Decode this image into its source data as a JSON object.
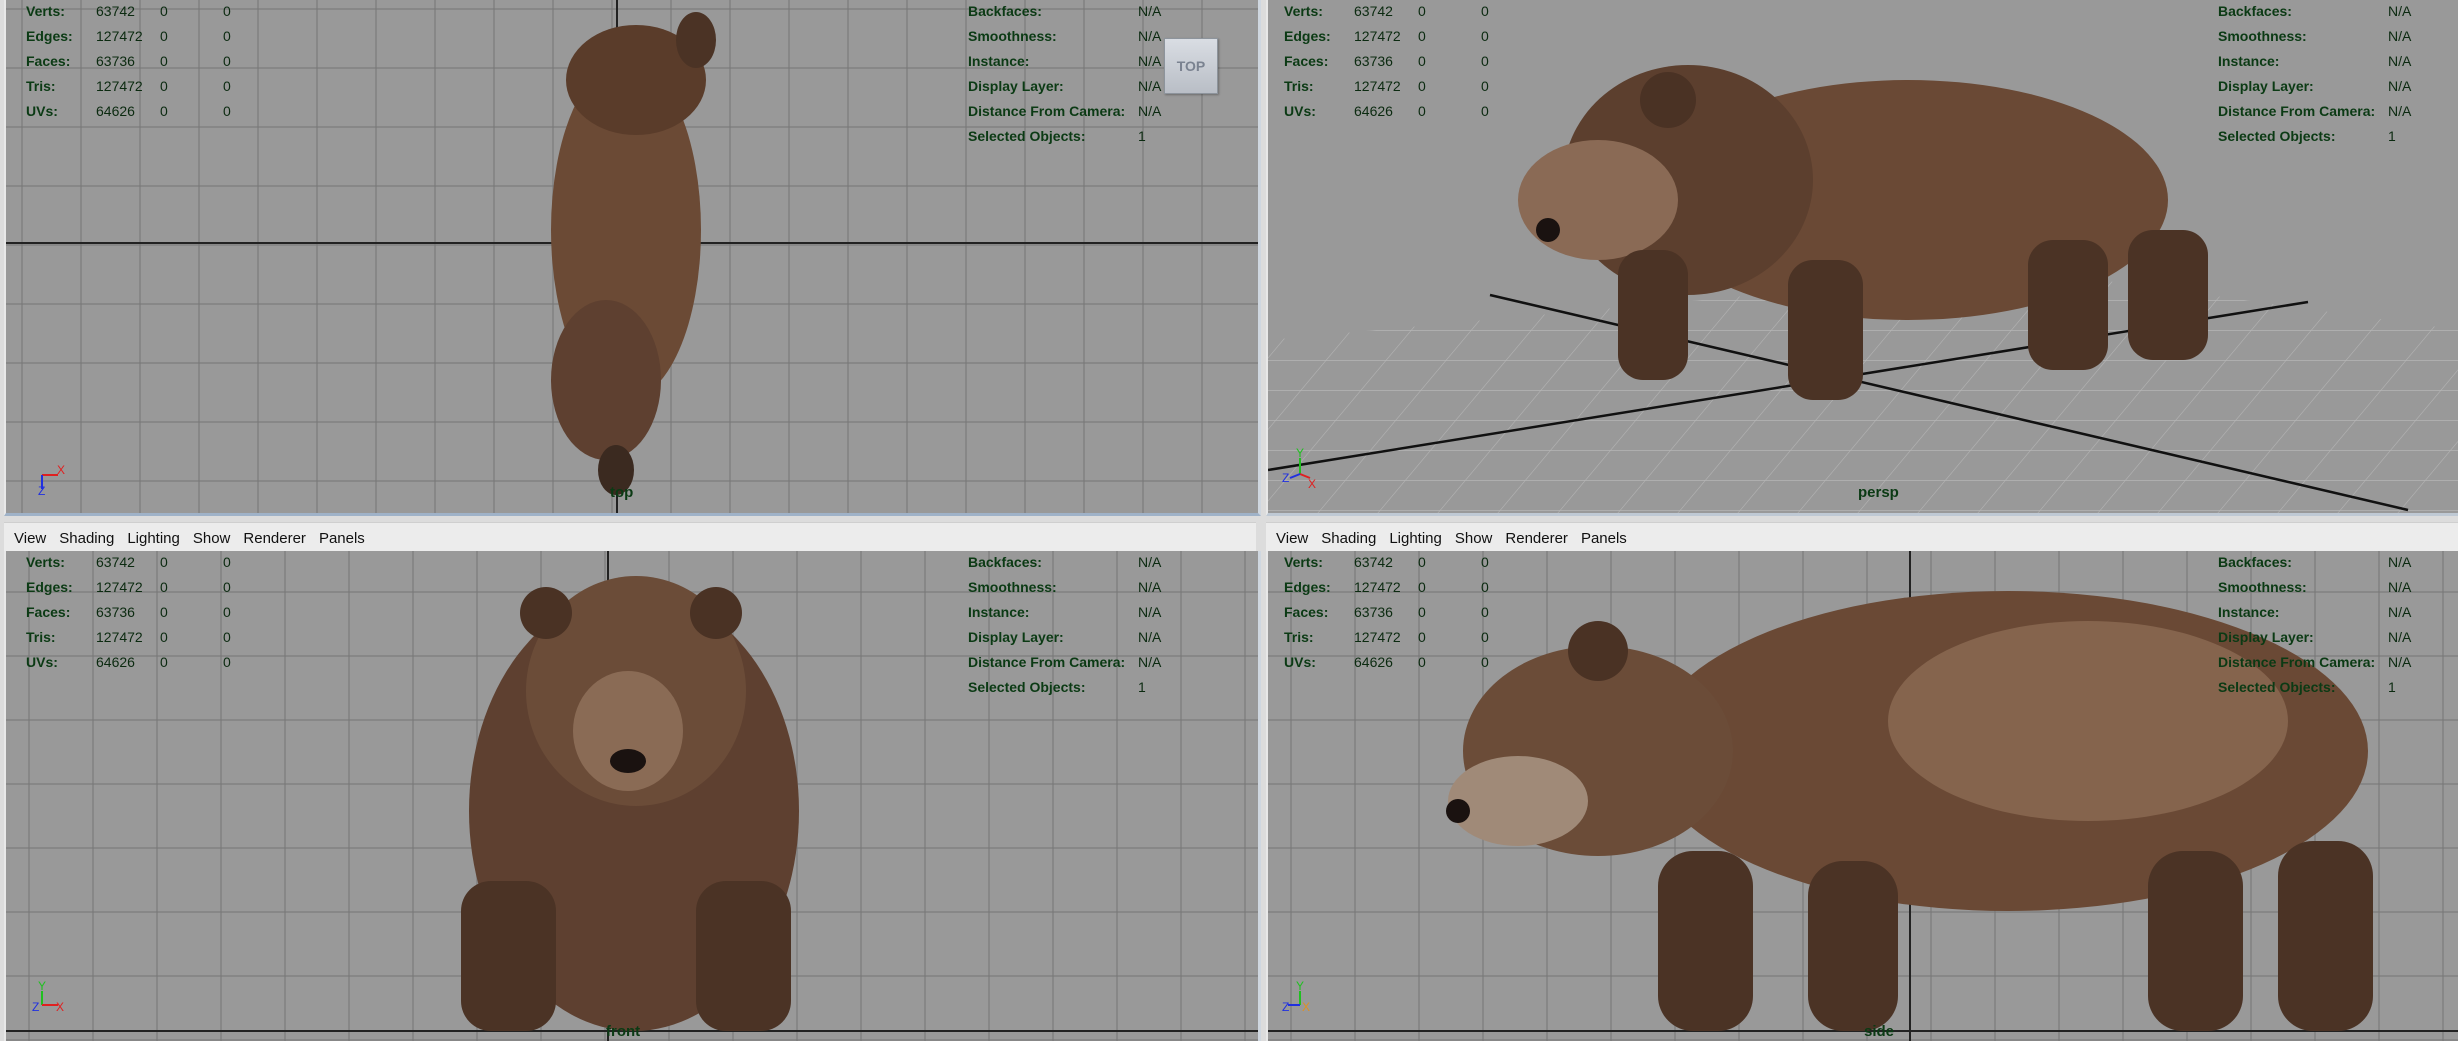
{
  "menubar": [
    "View",
    "Shading",
    "Lighting",
    "Show",
    "Renderer",
    "Panels"
  ],
  "stats": {
    "rows": [
      {
        "label": "Verts:",
        "value": "63742",
        "a": "0",
        "b": "0"
      },
      {
        "label": "Edges:",
        "value": "127472",
        "a": "0",
        "b": "0"
      },
      {
        "label": "Faces:",
        "value": "63736",
        "a": "0",
        "b": "0"
      },
      {
        "label": "Tris:",
        "value": "127472",
        "a": "0",
        "b": "0"
      },
      {
        "label": "UVs:",
        "value": "64626",
        "a": "0",
        "b": "0"
      }
    ]
  },
  "info": {
    "rows": [
      {
        "label": "Backfaces:",
        "value": "N/A"
      },
      {
        "label": "Smoothness:",
        "value": "N/A"
      },
      {
        "label": "Instance:",
        "value": "N/A"
      },
      {
        "label": "Display Layer:",
        "value": "N/A"
      },
      {
        "label": "Distance From Camera:",
        "value": "N/A"
      },
      {
        "label": "Selected Objects:",
        "value": "1"
      }
    ]
  },
  "viewports": {
    "top": {
      "camera": "top"
    },
    "persp": {
      "camera": "persp"
    },
    "front": {
      "camera": "front"
    },
    "side": {
      "camera": "side"
    }
  },
  "viewcube": {
    "label": "TOP"
  },
  "axes": {
    "x": "X",
    "y": "Y",
    "z": "Z"
  },
  "colors": {
    "hud_text": "#0b3a14",
    "viewport_bg": "#999999",
    "axis_x": "#e02020",
    "axis_y": "#20c020",
    "axis_z": "#2030e0"
  }
}
